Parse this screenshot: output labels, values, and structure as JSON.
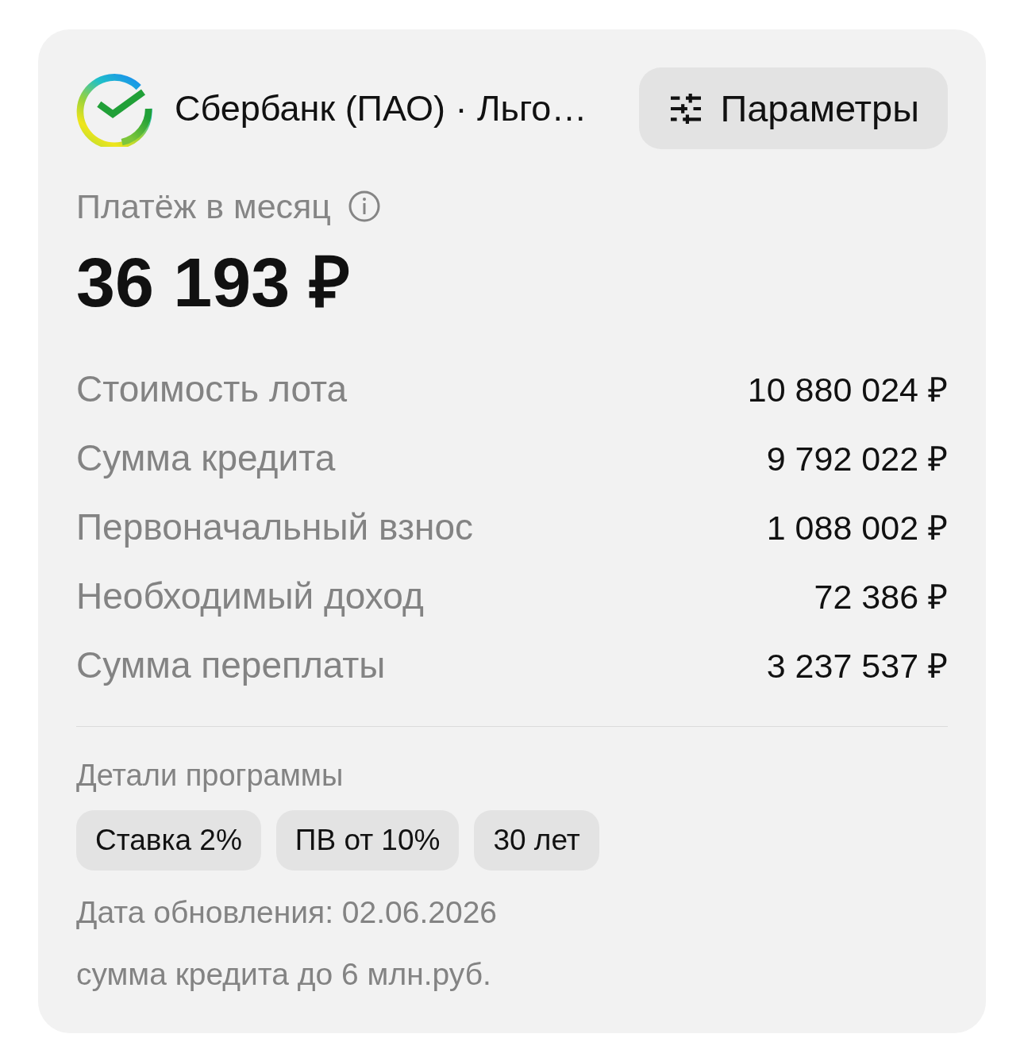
{
  "header": {
    "title": "Сбербанк (ПАО) · Льго…",
    "params_button": "Параметры"
  },
  "payment": {
    "label": "Платёж в месяц",
    "amount": "36 193 ₽"
  },
  "details": [
    {
      "label": "Стоимость лота",
      "value": "10 880 024 ₽"
    },
    {
      "label": "Сумма кредита",
      "value": "9 792 022 ₽"
    },
    {
      "label": "Первоначальный взнос",
      "value": "1 088 002 ₽"
    },
    {
      "label": "Необходимый доход",
      "value": "72 386 ₽"
    },
    {
      "label": "Сумма переплаты",
      "value": "3 237 537 ₽"
    }
  ],
  "program": {
    "title": "Детали программы",
    "tags": [
      "Ставка 2%",
      "ПВ от 10%",
      "30 лет"
    ]
  },
  "notes": [
    "Дата обновления: 02.06.2026",
    "сумма кредита до 6 млн.руб."
  ]
}
